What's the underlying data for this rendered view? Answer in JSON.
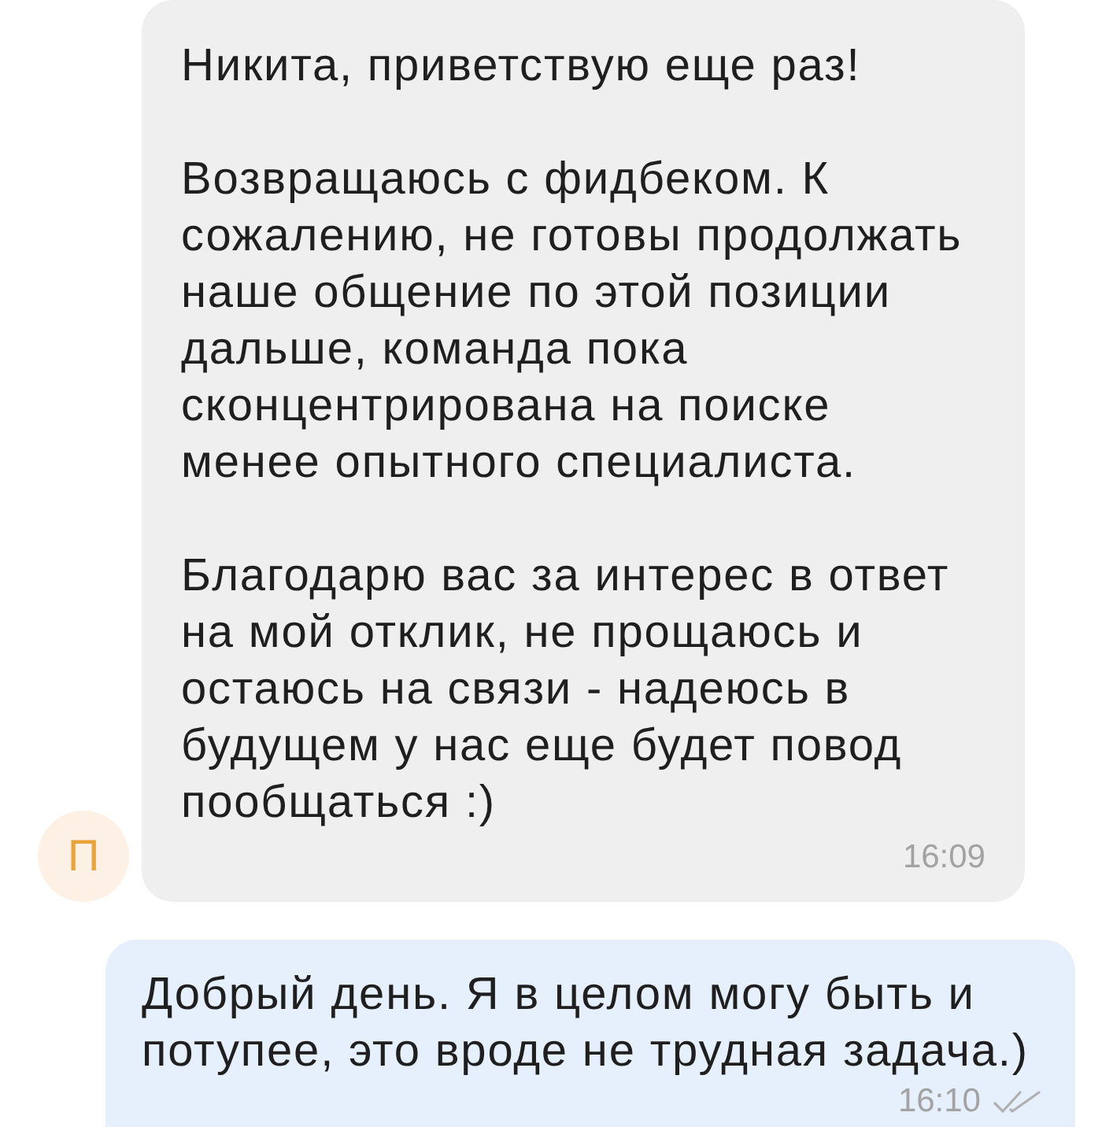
{
  "messages": [
    {
      "kind": "incoming",
      "sender_initial": "П",
      "paragraphs": [
        "Никита, приветствую еще раз!",
        "Возвращаюсь с фидбеком. К\nсожалению, не готовы продолжать\nнаше общение по этой позиции\nдальше, команда пока\nсконцентрирована на поиске\nменее опытного специалиста.",
        "Благодарю вас за интерес в ответ\nна мой отклик, не прощаюсь и\nостаюсь на связи - надеюсь в\nбудущем у нас еще будет повод\nпообщаться :)"
      ],
      "time": "16:09"
    },
    {
      "kind": "outgoing",
      "paragraphs": [
        "Добрый день. Я в целом могу быть и\nпотупее, это вроде не трудная задача.)"
      ],
      "time": "16:10",
      "read": true
    }
  ]
}
